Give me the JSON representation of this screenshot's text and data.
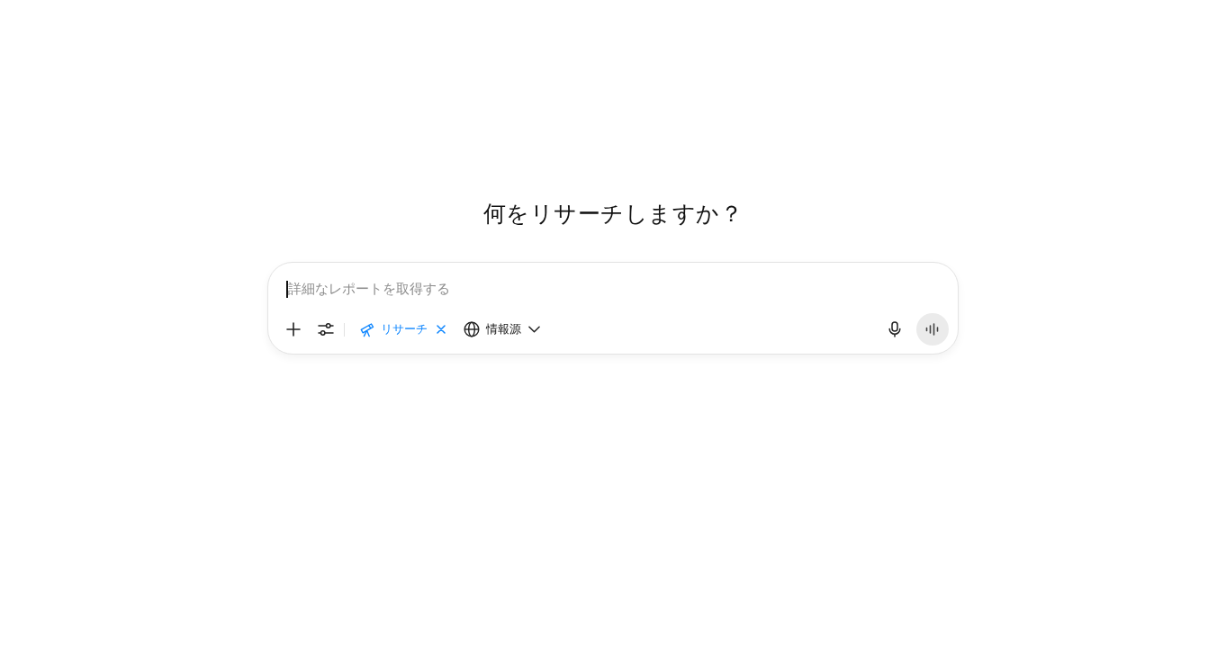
{
  "heading": "何をリサーチしますか？",
  "composer": {
    "placeholder": "詳細なレポートを取得する",
    "focused": true,
    "mode_chip": {
      "label": "リサーチ",
      "active": true
    },
    "sources": {
      "label": "情報源"
    }
  }
}
